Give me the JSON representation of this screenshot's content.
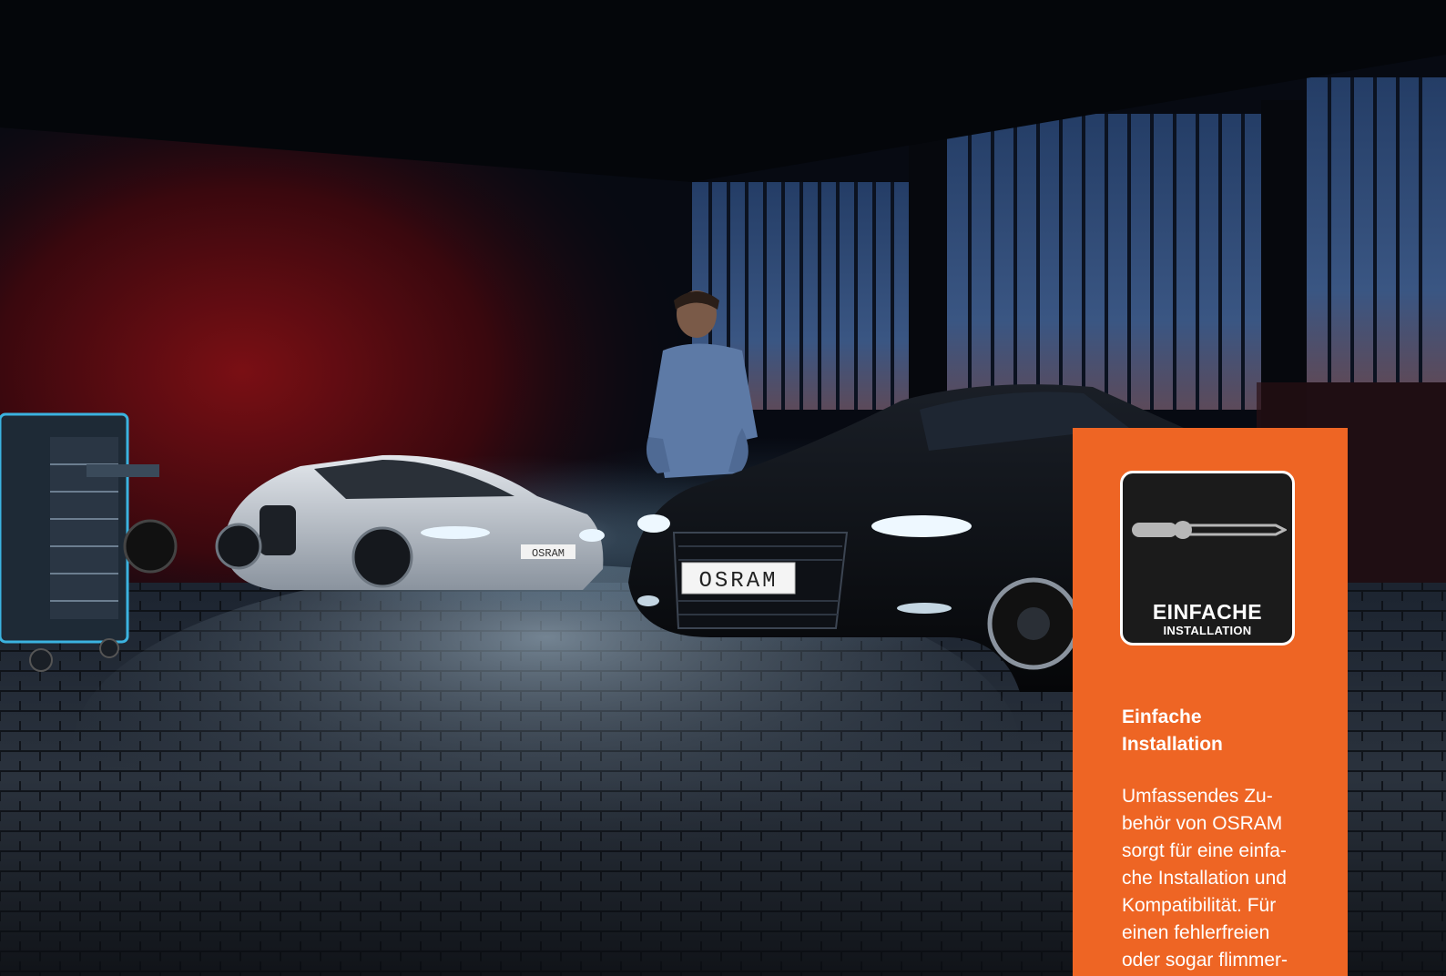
{
  "photo": {
    "plate_left": "OSRAM",
    "plate_right": "OSRAM"
  },
  "panel": {
    "background": "#ee6524",
    "badge": {
      "icon": "screwdriver-icon",
      "title": "EINFACHE",
      "subtitle": "INSTALLATION"
    },
    "heading": "Einfache\nInstallation",
    "body": "Umfassendes Zu-\nbehör von OSRAM\nsorgt für eine einfa-\nche Installation und\nKompatibilität. Für\neinen fehlerfreien\noder sogar flimmer-"
  }
}
